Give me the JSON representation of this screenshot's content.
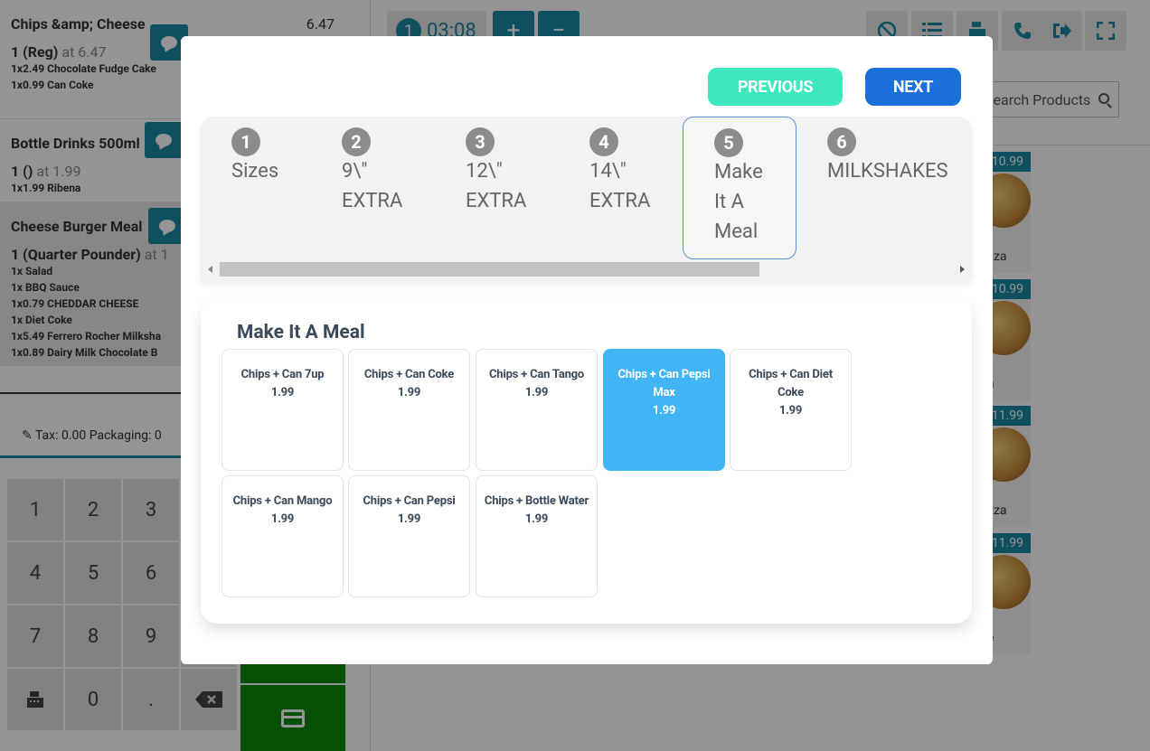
{
  "order": {
    "items": [
      {
        "name": "Chips &amp; Cheese",
        "price": "6.47",
        "qty": "1 (Reg)",
        "at": "at 6.47",
        "subs": [
          "1x2.49 Chocolate Fudge Cake",
          "1x0.99 Can Coke"
        ]
      },
      {
        "name": "Bottle Drinks 500ml",
        "price": "",
        "qty": "1 ()",
        "at": "at 1.99",
        "subs": [
          "1x1.99 Ribena"
        ]
      },
      {
        "name": "Cheese Burger Meal",
        "price": "",
        "qty": "1 (Quarter Pounder)",
        "at": "at 1",
        "subs": [
          "1x Salad",
          "1x BBQ Sauce",
          "1x0.79 CHEDDAR CHEESE",
          "1x Diet Coke",
          "1x5.49 Ferrero Rocher Milksha",
          "1x0.89 Dairy Milk Chocolate B"
        ]
      }
    ],
    "tax_line": "Tax: 0.00 Packaging: 0"
  },
  "numpad": {
    "keys": [
      "1",
      "2",
      "3",
      "",
      "4",
      "5",
      "6",
      "",
      "7",
      "8",
      "9",
      "",
      "cash-register-icon",
      "0",
      ".",
      "backspace-icon"
    ]
  },
  "header": {
    "timer_number": "1",
    "timer_value": "03:08",
    "plus_label": "+",
    "minus_label": "−",
    "tools": [
      "ban-icon",
      "list-icon",
      "cash-register-icon",
      "phone-icon",
      "sign-out-icon",
      "fullscreen-icon"
    ]
  },
  "search": {
    "placeholder": "Search Products"
  },
  "products": [
    {
      "price": "10.99",
      "name": "zza"
    },
    {
      "price": "10.99",
      "name": "a"
    },
    {
      "price": "11.99",
      "name": "zza"
    },
    {
      "price": "11.99",
      "name": "e"
    }
  ],
  "modal": {
    "prev_label": "PREVIOUS",
    "next_label": "NEXT",
    "steps": [
      {
        "num": "1",
        "label": "Sizes"
      },
      {
        "num": "2",
        "label": "9\\\" EXTRA"
      },
      {
        "num": "3",
        "label": "12\\\" EXTRA"
      },
      {
        "num": "4",
        "label": "14\\\" EXTRA"
      },
      {
        "num": "5",
        "label": "Make It A Meal"
      },
      {
        "num": "6",
        "label": "MILKSHAKES"
      }
    ],
    "active_step": "5",
    "section_title": "Make It A Meal",
    "options": [
      {
        "name": "Chips + Can 7up",
        "price": "1.99"
      },
      {
        "name": "Chips + Can Coke",
        "price": "1.99"
      },
      {
        "name": "Chips + Can Tango",
        "price": "1.99"
      },
      {
        "name": "Chips + Can Pepsi Max",
        "price": "1.99"
      },
      {
        "name": "Chips + Can Diet Coke",
        "price": "1.99"
      },
      {
        "name": "Chips + Can Mango",
        "price": "1.99"
      },
      {
        "name": "Chips + Can Pepsi",
        "price": "1.99"
      },
      {
        "name": "Chips + Bottle Water",
        "price": "1.99"
      }
    ],
    "selected_option": "Chips + Can Pepsi Max"
  },
  "colors": {
    "teal": "#1a8ba6",
    "green": "#0a8a0a",
    "prev": "#3de8c0",
    "next": "#1a6fd9",
    "selected": "#41b5f5"
  }
}
